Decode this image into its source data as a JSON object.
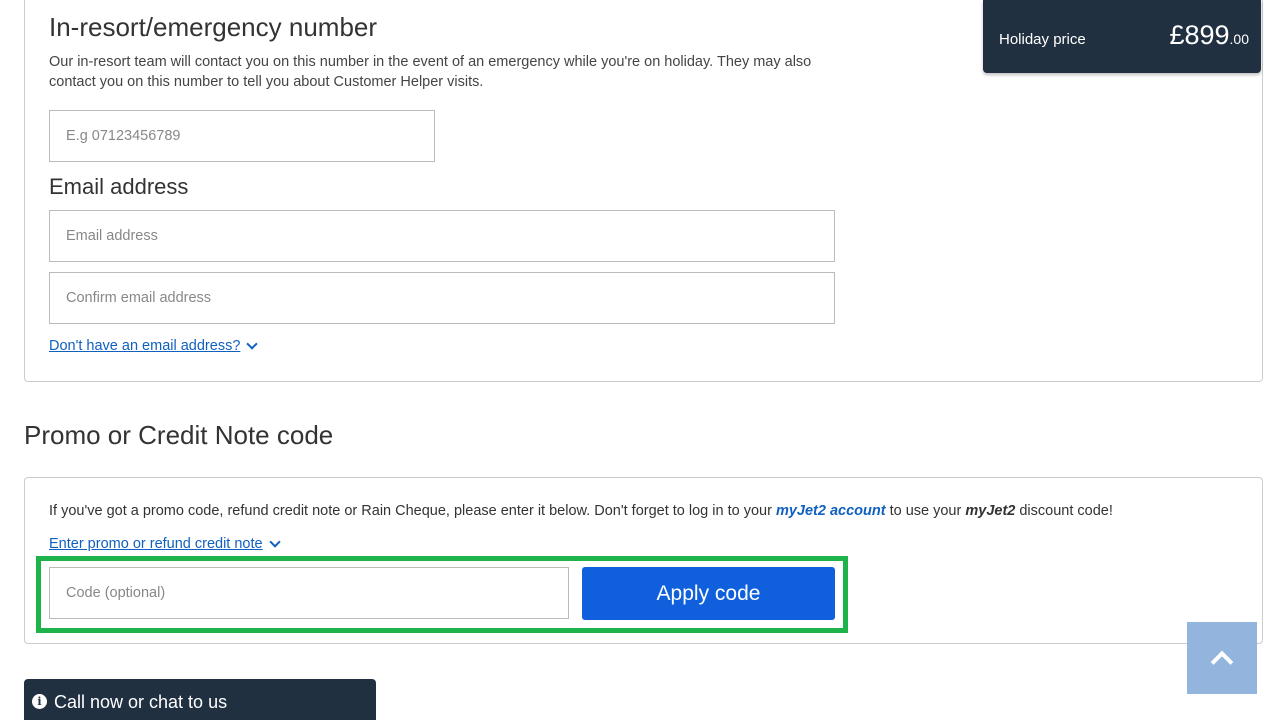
{
  "contact": {
    "emergency_title": "In-resort/emergency number",
    "emergency_desc": "Our in-resort team will contact you on this number in the event of an emergency while you're on holiday. They may also contact you on this number to tell you about Customer Helper visits.",
    "phone_placeholder": "E.g 07123456789",
    "email_title": "Email address",
    "email_placeholder": "Email address",
    "confirm_email_placeholder": "Confirm email address",
    "no_email_link": "Don't have an email address?"
  },
  "price": {
    "label": "Holiday price",
    "amount": "£899",
    "pence": ".00"
  },
  "promo": {
    "title": "Promo or Credit Note code",
    "text_before": "If you've got a promo code, refund credit note or Rain Cheque, please enter it below. Don't forget to log in to your ",
    "account_link": "myJet2 account",
    "text_middle": " to use your ",
    "brand": "myJet2",
    "text_after": " discount code!",
    "toggle_link": "Enter promo or refund credit note",
    "code_placeholder": "Code (optional)",
    "apply_label": "Apply code"
  },
  "chat": {
    "info_glyph": "i",
    "label": "Call now or chat to us"
  },
  "colors": {
    "accent": "#1060dd",
    "dark": "#203040",
    "highlight": "#1db34a"
  }
}
